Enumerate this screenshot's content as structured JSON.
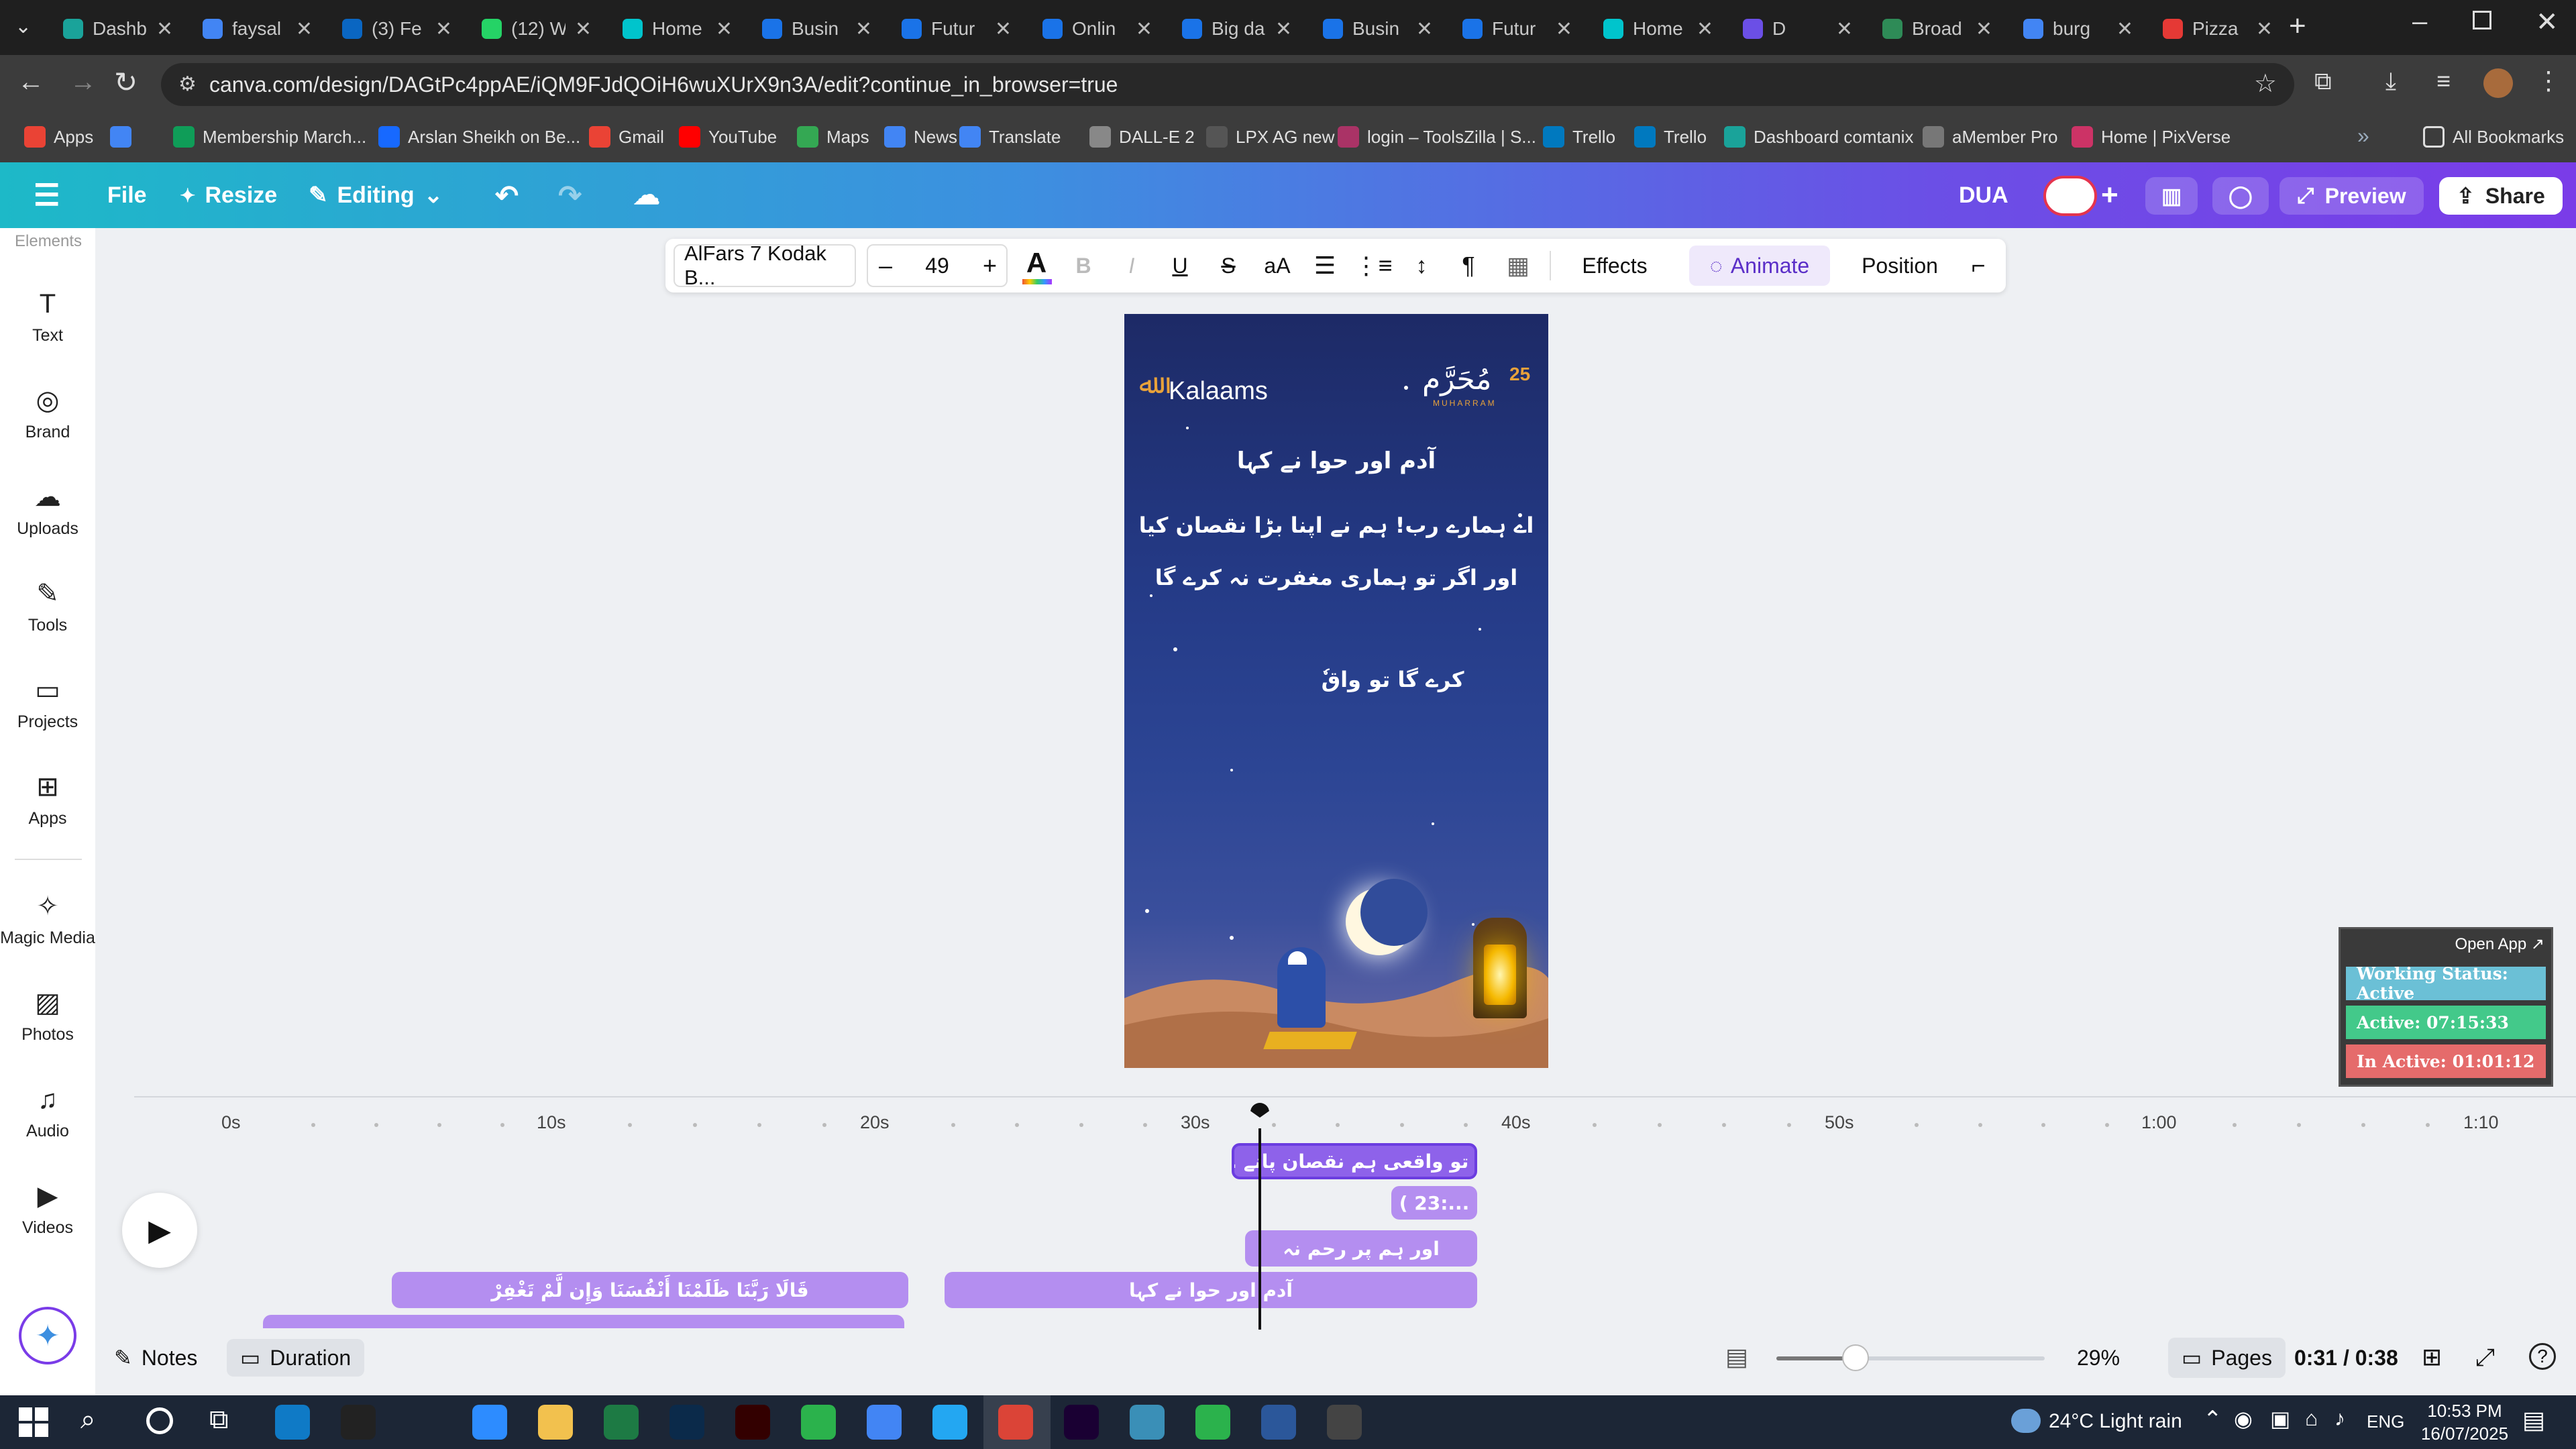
{
  "browser": {
    "tabs": [
      {
        "title": "Dashb",
        "color": "#1aa39a"
      },
      {
        "title": "faysal",
        "color": "#4285f4"
      },
      {
        "title": "(3) Fe",
        "color": "#0a66c2"
      },
      {
        "title": "(12) W",
        "color": "#25d366"
      },
      {
        "title": "Home",
        "color": "#00c4cc"
      },
      {
        "title": "Busin",
        "color": "#1a73e8"
      },
      {
        "title": "Futur",
        "color": "#1a73e8"
      },
      {
        "title": "Onlin",
        "color": "#1a73e8"
      },
      {
        "title": "Big da",
        "color": "#1a73e8"
      },
      {
        "title": "Busin",
        "color": "#1a73e8"
      },
      {
        "title": "Futur",
        "color": "#1a73e8"
      },
      {
        "title": "Home",
        "color": "#00c4cc"
      },
      {
        "title": "D",
        "color": "#6b4fe6"
      },
      {
        "title": "Broad",
        "color": "#2e8b57"
      },
      {
        "title": "burg",
        "color": "#4285f4"
      },
      {
        "title": "Pizza",
        "color": "#e53935"
      }
    ],
    "url": "canva.com/design/DAGtPc4ppAE/iQM9FJdQOiH6wuXUrX9n3A/edit?continue_in_browser=true",
    "bookmarks": [
      {
        "label": "Apps",
        "color": "#ea4335"
      },
      {
        "label": "",
        "color": "#4285f4"
      },
      {
        "label": "Membership March...",
        "color": "#0f9d58"
      },
      {
        "label": "Arslan Sheikh on Be...",
        "color": "#1769ff"
      },
      {
        "label": "Gmail",
        "color": "#ea4335"
      },
      {
        "label": "YouTube",
        "color": "#ff0000"
      },
      {
        "label": "Maps",
        "color": "#34a853"
      },
      {
        "label": "News",
        "color": "#4285f4"
      },
      {
        "label": "Translate",
        "color": "#4285f4"
      },
      {
        "label": "DALL-E 2",
        "color": "#888888"
      },
      {
        "label": "LPX AG new",
        "color": "#555555"
      },
      {
        "label": "login – ToolsZilla | S...",
        "color": "#aa3366"
      },
      {
        "label": "Trello",
        "color": "#0079bf"
      },
      {
        "label": "Trello",
        "color": "#0079bf"
      },
      {
        "label": "Dashboard comtanix",
        "color": "#1aa39a"
      },
      {
        "label": "aMember Pro",
        "color": "#777777"
      },
      {
        "label": "Home | PixVerse",
        "color": "#cc3366"
      }
    ],
    "all_bookmarks": "All Bookmarks"
  },
  "header": {
    "file": "File",
    "resize": "Resize",
    "editing": "Editing",
    "design_name": "DUA",
    "preview": "Preview",
    "share": "Share"
  },
  "rail": {
    "clipped": "Elements",
    "items": [
      {
        "label": "Text",
        "icon": "text-icon"
      },
      {
        "label": "Brand",
        "icon": "brand-icon"
      },
      {
        "label": "Uploads",
        "icon": "cloud-upload-icon"
      },
      {
        "label": "Tools",
        "icon": "pen-icon"
      },
      {
        "label": "Projects",
        "icon": "folder-icon"
      },
      {
        "label": "Apps",
        "icon": "apps-icon"
      },
      {
        "label": "Magic Media",
        "icon": "magic-media-icon"
      },
      {
        "label": "Photos",
        "icon": "photo-icon"
      },
      {
        "label": "Audio",
        "icon": "music-icon"
      },
      {
        "label": "Videos",
        "icon": "video-icon"
      }
    ]
  },
  "toolbar": {
    "font": "AlFars 7 Kodak B...",
    "size": "49",
    "effects": "Effects",
    "animate": "Animate",
    "position": "Position"
  },
  "design": {
    "brand": "Kalaams",
    "month_text": "مُحَرَّم",
    "month_day": "25",
    "month_latin": "MUHARRAM",
    "line1": "آدم اور حوا نے کہا",
    "line2": "اے ہمارے رب! ہم نے اپنا بڑا نقصان کیا",
    "line3": "اور اگر تو ہماری مغفرت نہ کرے گا",
    "line4": "کرے گا تو واقٗ"
  },
  "timeline": {
    "ticks": [
      "0s",
      "10s",
      "20s",
      "30s",
      "40s",
      "50s",
      "1:00",
      "1:10"
    ],
    "clips": [
      {
        "text": "... گا تو واقعی ہم نقصان پانے"
      },
      {
        "text": "( 23:..."
      },
      {
        "text": "اور ہم پر رحم نہ"
      },
      {
        "text": "قَالَا رَبَّنَا ظَلَمْنَا أَنْفُسَنَا وَإِن لَّمْ تَغْفِرْ"
      },
      {
        "text": "آدم اور حوا نے کہا"
      }
    ]
  },
  "footer": {
    "notes": "Notes",
    "duration": "Duration",
    "zoom": "29%",
    "pages": "Pages",
    "time": "0:31 / 0:38"
  },
  "widget": {
    "open_app": "Open App ↗",
    "status": "Working Status: Active",
    "active": "Active: 07:15:33",
    "inactive": "In Active: 01:01:12"
  },
  "taskbar": {
    "weather": "24°C  Light rain",
    "lang": "ENG",
    "time": "10:53 PM",
    "date": "16/07/2025"
  }
}
